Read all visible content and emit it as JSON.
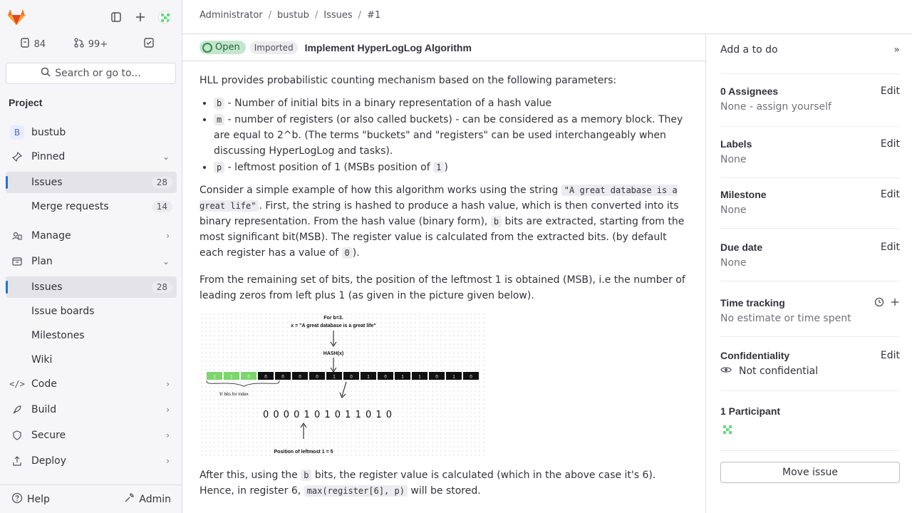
{
  "sidebar": {
    "merge_count": "84",
    "todo_count": "99+",
    "search_placeholder": "Search or go to...",
    "section_title": "Project",
    "project_letter": "B",
    "project_name": "bustub",
    "items": {
      "pinned": "Pinned",
      "pinned_issues": "Issues",
      "pinned_issues_count": "28",
      "merge_requests": "Merge requests",
      "merge_requests_count": "14",
      "manage": "Manage",
      "plan": "Plan",
      "issues": "Issues",
      "issues_count": "28",
      "issue_boards": "Issue boards",
      "milestones": "Milestones",
      "wiki": "Wiki",
      "code": "Code",
      "build": "Build",
      "secure": "Secure",
      "deploy": "Deploy"
    },
    "help": "Help",
    "admin": "Admin"
  },
  "breadcrumb": [
    "Administrator",
    "bustub",
    "Issues",
    "#1"
  ],
  "issue": {
    "status": "Open",
    "imported": "Imported",
    "title": "Implement HyperLogLog Algorithm",
    "intro": "HLL provides probabilistic counting mechanism based on the following parameters:",
    "bullets": [
      {
        "code": "b",
        "text": " - Number of initial bits in a binary representation of a hash value"
      },
      {
        "code": "m",
        "text": " - number of registers (or also called buckets) - can be considered as a memory block. They are equal to 2^b. (The terms \"buckets\" and \"registers\" can be used interchangeably when discussing HyperLogLog and tasks)."
      },
      {
        "code": "p",
        "text": " - leftmost position of 1 (MSBs position of ",
        "code2": "1",
        "tail": ")"
      }
    ],
    "para2": {
      "a": "Consider a simple example of how this algorithm works using the string ",
      "code1": "\"A great database is a great life\"",
      "b": ". First, the string is hashed to produce a hash value, which is then converted into its binary representation. From the hash value (binary form), ",
      "code2": "b",
      "c": " bits are extracted, starting from the most significant bit(MSB). The register value is calculated from the extracted bits. (by default each register has a value of ",
      "code3": "0",
      "d": ")."
    },
    "para3": "From the remaining set of bits, the position of the leftmost 1 is obtained (MSB), i.e the number of leading zeros from left plus 1 (as given in the picture given below).",
    "figure": {
      "line1": "For b=3.",
      "line2": "x = \"A great database is a great life\"",
      "hash": "HASH(x)",
      "bits": [
        "1",
        "1",
        "0",
        "0",
        "0",
        "0",
        "0",
        "1",
        "0",
        "1",
        "0",
        "1",
        "1",
        "0",
        "1",
        "0"
      ],
      "index_label": "'b' bits for index",
      "binary": "0 0 0 0 1 0 1 0 1 1 0 1 0",
      "caption": "Position of leftmost 1 = 5"
    },
    "para4": {
      "a": "After this, using the ",
      "code1": "b",
      "b": " bits, the register value is calculated (which in the above case it's 6). Hence, in register 6, ",
      "code2": "max(register[6], p)",
      "c": " will be stored."
    }
  },
  "right": {
    "todo": "Add a to do",
    "assignees_title": "0 Assignees",
    "assignees_none": "None - ",
    "assign_yourself": "assign yourself",
    "labels_title": "Labels",
    "labels_value": "None",
    "milestone_title": "Milestone",
    "milestone_value": "None",
    "due_title": "Due date",
    "due_value": "None",
    "time_title": "Time tracking",
    "time_value": "No estimate or time spent",
    "conf_title": "Confidentiality",
    "conf_value": "Not confidential",
    "participants_title": "1 Participant",
    "edit": "Edit",
    "move": "Move issue"
  }
}
